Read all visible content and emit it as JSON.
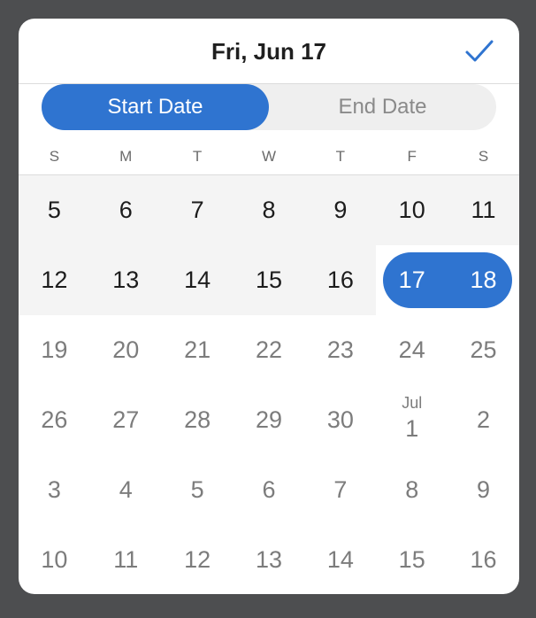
{
  "header": {
    "title": "Fri, Jun 17"
  },
  "segmented": {
    "start_label": "Start Date",
    "end_label": "End Date",
    "active": "start"
  },
  "weekdays": [
    "S",
    "M",
    "T",
    "W",
    "T",
    "F",
    "S"
  ],
  "weeks": [
    [
      {
        "day": "5",
        "state": "current"
      },
      {
        "day": "6",
        "state": "current"
      },
      {
        "day": "7",
        "state": "current"
      },
      {
        "day": "8",
        "state": "current"
      },
      {
        "day": "9",
        "state": "current"
      },
      {
        "day": "10",
        "state": "current"
      },
      {
        "day": "11",
        "state": "current"
      }
    ],
    [
      {
        "day": "12",
        "state": "current"
      },
      {
        "day": "13",
        "state": "current"
      },
      {
        "day": "14",
        "state": "current"
      },
      {
        "day": "15",
        "state": "current"
      },
      {
        "day": "16",
        "state": "current"
      },
      {
        "day": "17",
        "state": "selected"
      },
      {
        "day": "18",
        "state": "selected"
      }
    ],
    [
      {
        "day": "19",
        "state": "future"
      },
      {
        "day": "20",
        "state": "future"
      },
      {
        "day": "21",
        "state": "future"
      },
      {
        "day": "22",
        "state": "future"
      },
      {
        "day": "23",
        "state": "future"
      },
      {
        "day": "24",
        "state": "future"
      },
      {
        "day": "25",
        "state": "future"
      }
    ],
    [
      {
        "day": "26",
        "state": "future"
      },
      {
        "day": "27",
        "state": "future"
      },
      {
        "day": "28",
        "state": "future"
      },
      {
        "day": "29",
        "state": "future"
      },
      {
        "day": "30",
        "state": "future"
      },
      {
        "day": "1",
        "state": "future",
        "month": "Jul"
      },
      {
        "day": "2",
        "state": "future"
      }
    ],
    [
      {
        "day": "3",
        "state": "future"
      },
      {
        "day": "4",
        "state": "future"
      },
      {
        "day": "5",
        "state": "future"
      },
      {
        "day": "6",
        "state": "future"
      },
      {
        "day": "7",
        "state": "future"
      },
      {
        "day": "8",
        "state": "future"
      },
      {
        "day": "9",
        "state": "future"
      }
    ],
    [
      {
        "day": "10",
        "state": "future"
      },
      {
        "day": "11",
        "state": "future"
      },
      {
        "day": "12",
        "state": "future"
      },
      {
        "day": "13",
        "state": "future"
      },
      {
        "day": "14",
        "state": "future"
      },
      {
        "day": "15",
        "state": "future"
      },
      {
        "day": "16",
        "state": "future"
      }
    ]
  ],
  "colors": {
    "accent": "#2f74d0",
    "current_week_band": "#f4f4f4",
    "current_text": "#1c1c1c",
    "future_text": "#7c7c7c"
  },
  "icons": {
    "done": "checkmark-icon"
  }
}
